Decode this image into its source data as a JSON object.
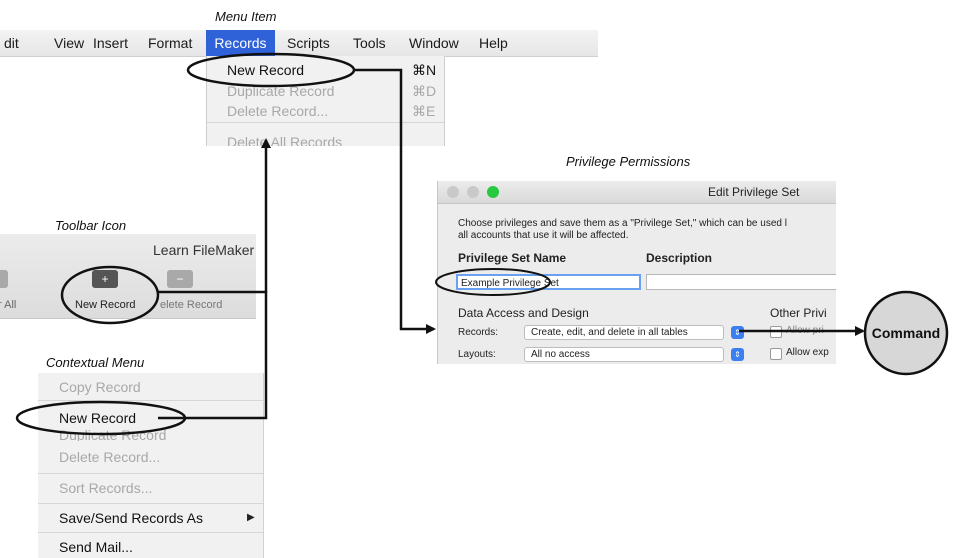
{
  "captions": {
    "menu_item": "Menu Item",
    "privilege_permissions": "Privilege Permissions",
    "toolbar_icon": "Toolbar Icon",
    "contextual_menu": "Contextual Menu"
  },
  "menubar": {
    "items": [
      "dit",
      "View",
      "Insert",
      "Format",
      "Records",
      "Scripts",
      "Tools",
      "Window",
      "Help"
    ],
    "active": "Records"
  },
  "records_menu": {
    "items": [
      {
        "label": "New Record",
        "shortcut": "⌘N",
        "enabled": true
      },
      {
        "label": "Duplicate Record",
        "shortcut": "⌘D",
        "enabled": false
      },
      {
        "label": "Delete Record...",
        "shortcut": "⌘E",
        "enabled": false
      },
      {
        "label": "Delete All Records",
        "shortcut": "",
        "enabled": false
      }
    ]
  },
  "toolbar": {
    "title": "Learn FileMaker",
    "show_all_label": "r All",
    "new_record_label": "New Record",
    "delete_record_label": "elete Record",
    "new_record_icon": "plus-square-icon",
    "delete_record_icon": "minus-square-icon"
  },
  "context_menu": {
    "items": [
      {
        "label": "Copy Record",
        "enabled": false
      },
      {
        "label": "New Record",
        "enabled": true
      },
      {
        "label": "Duplicate Record",
        "enabled": false
      },
      {
        "label": "Delete Record...",
        "enabled": false
      },
      {
        "label": "Sort Records...",
        "enabled": false
      },
      {
        "label": "Save/Send Records As",
        "enabled": true
      },
      {
        "label": "Send Mail...",
        "enabled": true
      }
    ],
    "submenu_arrow": "▶"
  },
  "privilege_dialog": {
    "title": "Edit Privilege Set",
    "description_line1": "Choose privileges and save them as a \"Privilege Set,\" which can be used l",
    "description_line2": "all accounts that use it will be affected.",
    "name_label": "Privilege Set Name",
    "description_label": "Description",
    "name_value": "Example Privilege Set",
    "section_data_access": "Data Access and Design",
    "section_other": "Other Privi",
    "records_label": "Records:",
    "records_value": "Create, edit, and delete in all tables",
    "layouts_label": "Layouts:",
    "layouts_value": "All no access",
    "other_option_1": "Allow pri",
    "other_option_2": "Allow exp"
  },
  "command": {
    "label": "Command"
  },
  "colors": {
    "menu_highlight": "#2f62d8",
    "traffic_close": "#c9c9c9",
    "traffic_min": "#c9c9c9",
    "traffic_max": "#27c93f",
    "select_button": "#3b7ff0",
    "callout_fill": "#d7d7d7"
  }
}
